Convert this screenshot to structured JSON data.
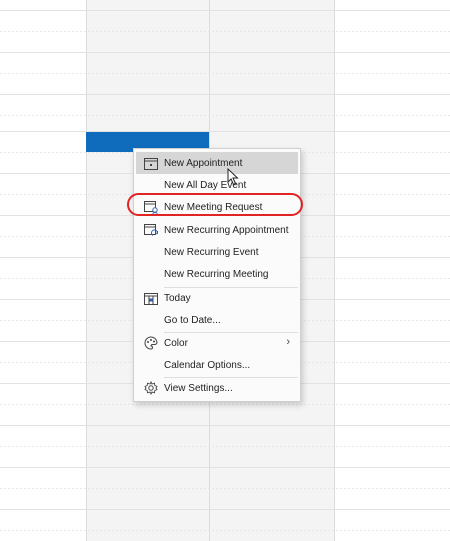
{
  "menu": {
    "items": [
      {
        "label": "New Appointment",
        "icon": "calendar-icon",
        "hover": true
      },
      {
        "label": "New All Day Event",
        "icon": ""
      },
      {
        "label": "New Meeting Request",
        "icon": "meeting-request-icon"
      },
      {
        "label": "New Recurring Appointment",
        "icon": "recurring-appointment-icon"
      },
      {
        "label": "New Recurring Event",
        "icon": ""
      },
      {
        "label": "New Recurring Meeting",
        "icon": ""
      },
      {
        "label": "Today",
        "icon": "today-icon"
      },
      {
        "label": "Go to Date...",
        "icon": ""
      },
      {
        "label": "Color",
        "icon": "color-icon",
        "submenu": true
      },
      {
        "label": "Calendar Options...",
        "icon": ""
      },
      {
        "label": "View Settings...",
        "icon": "gear-icon"
      }
    ]
  },
  "colors": {
    "accent": "#0f6cbd",
    "highlight_ring": "#e02424",
    "hover": "#d6d6d6"
  }
}
